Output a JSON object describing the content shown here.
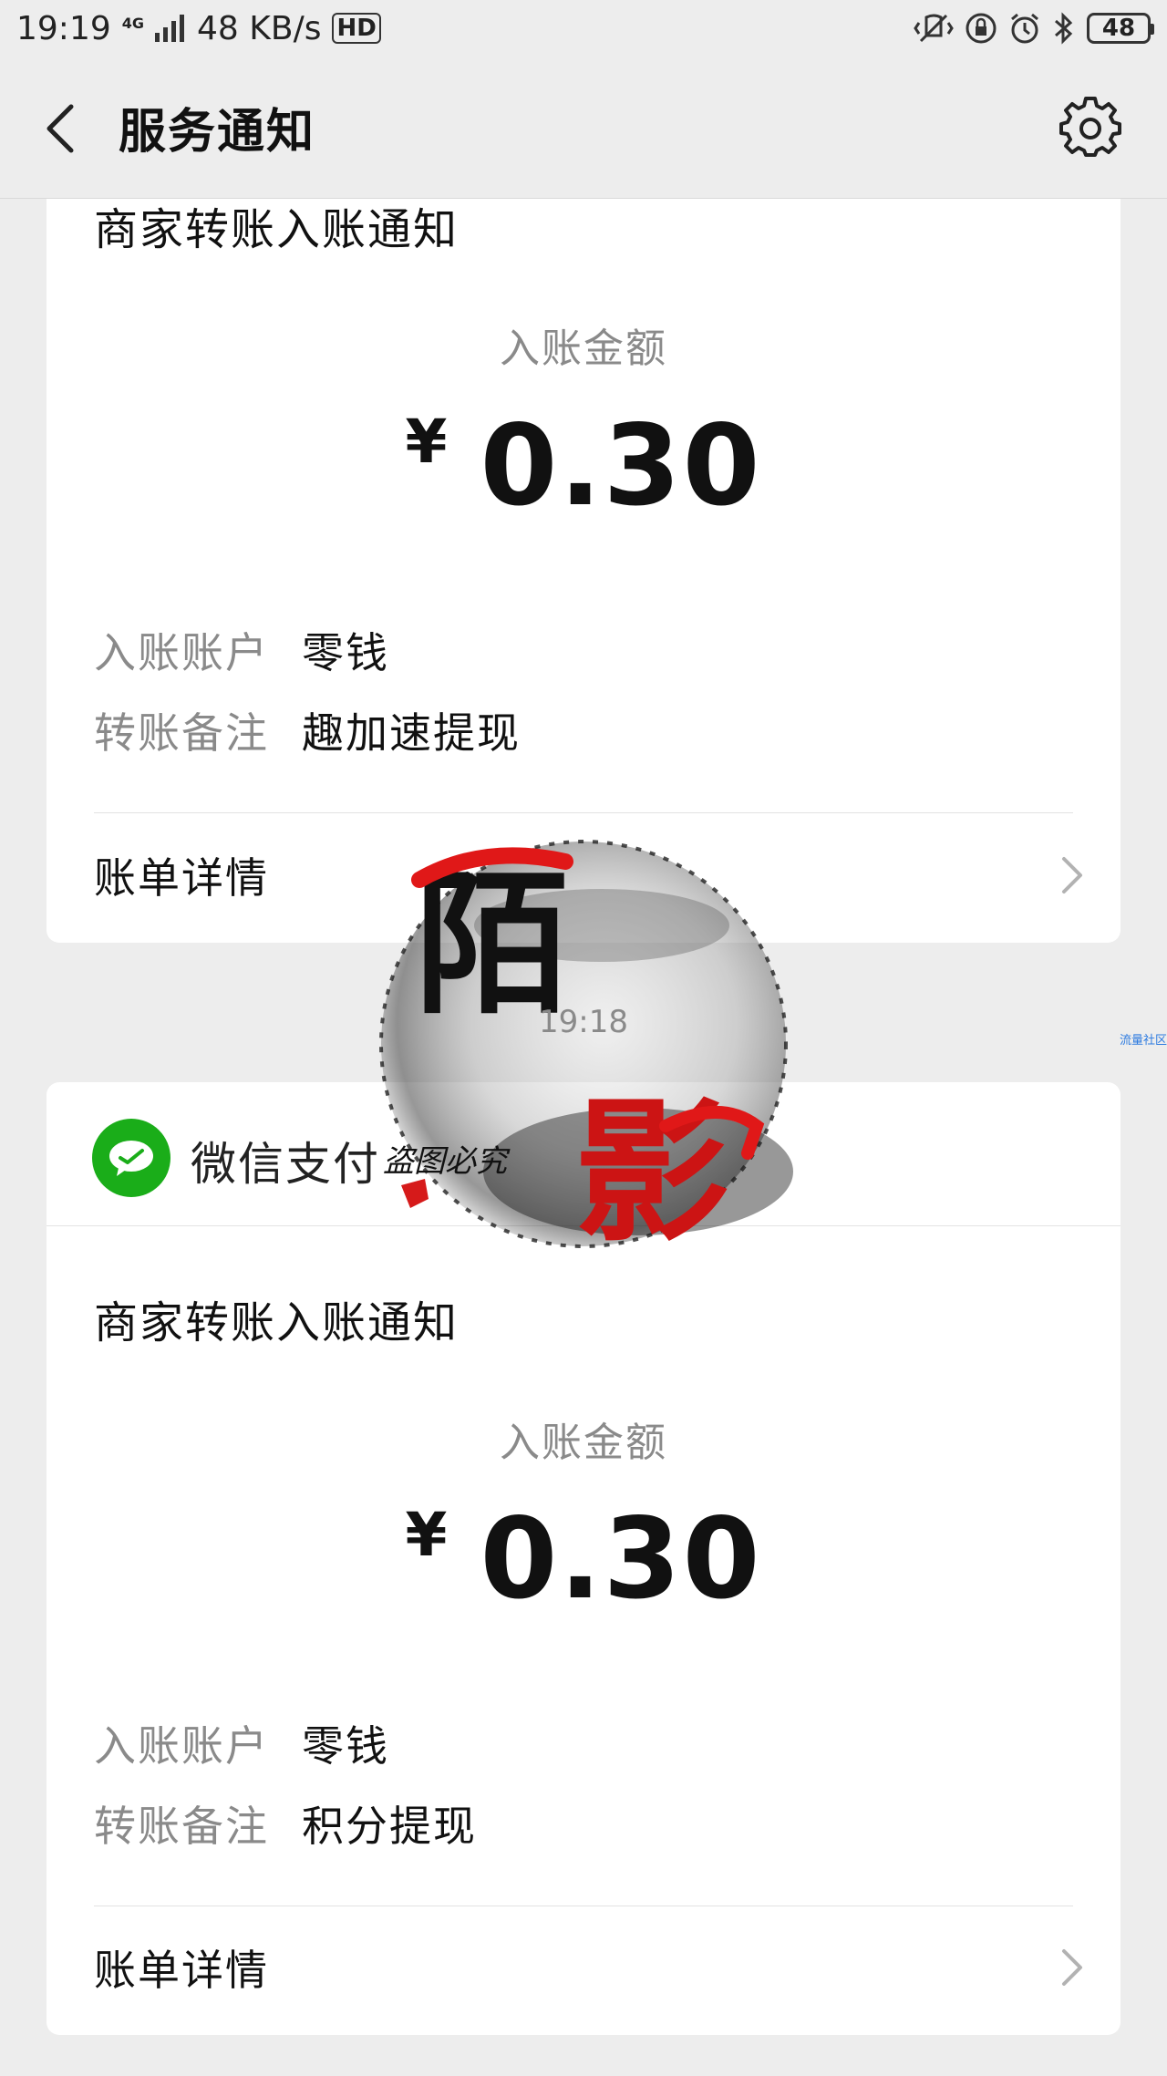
{
  "status_bar": {
    "time": "19:19",
    "network": "4G",
    "speed": "48 KB/s",
    "hd": "HD",
    "battery": "48"
  },
  "header": {
    "title": "服务通知"
  },
  "notifications": [
    {
      "title": "商家转账入账通知",
      "amount_label": "入账金额",
      "currency": "¥",
      "amount": "0.30",
      "account_label": "入账账户",
      "account_value": "零钱",
      "remark_label": "转账备注",
      "remark_value": "趣加速提现",
      "bill_detail": "账单详情"
    },
    {
      "sender": "微信支付",
      "title": "商家转账入账通知",
      "amount_label": "入账金额",
      "currency": "¥",
      "amount": "0.30",
      "account_label": "入账账户",
      "account_value": "零钱",
      "remark_label": "转账备注",
      "remark_value": "积分提现",
      "bill_detail": "账单详情"
    }
  ],
  "timestamp": "19:18",
  "watermark": {
    "text_1": "陌",
    "text_2": "影",
    "text_3": "盗图必究",
    "side_text": "流量社区"
  },
  "colors": {
    "background": "#ededed",
    "card": "#ffffff",
    "wechat_green": "#1aad19",
    "secondary_text": "#8a8a8a"
  }
}
